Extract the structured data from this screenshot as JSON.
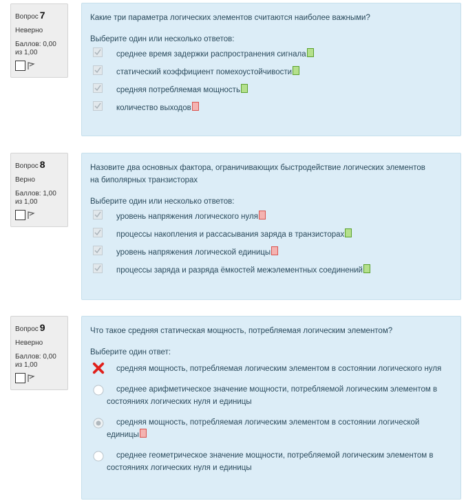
{
  "questions": [
    {
      "label": "Вопрос",
      "number": "7",
      "state": "Неверно",
      "grade_line1": "Баллов: 0,00",
      "grade_line2": "из 1,00",
      "text": "Какие три параметра логических элементов считаются наиболее важными?",
      "prompt": "Выберите один или несколько ответов:",
      "answers": [
        {
          "text": "среднее время задержки распространения сигнала",
          "correct": true
        },
        {
          "text": "статический коэффициент помехоустойчивости",
          "correct": true
        },
        {
          "text": "средняя потребляемая мощность",
          "correct": true
        },
        {
          "text": "количество выходов",
          "correct": false
        }
      ]
    },
    {
      "label": "Вопрос",
      "number": "8",
      "state": "Верно",
      "grade_line1": "Баллов: 1,00",
      "grade_line2": "из 1,00",
      "text_line1": "Назовите два основных фактора, ограничивающих быстродействие логических элементов",
      "text_line2": "на биполярных транзисторах",
      "prompt": "Выберите один или несколько ответов:",
      "answers": [
        {
          "text": "уровень напряжения логического нуля",
          "correct": false
        },
        {
          "text": "процессы накопления и рассасывания заряда в транзисторах",
          "correct": true
        },
        {
          "text": "уровень напряжения логической единицы",
          "correct": false
        },
        {
          "text": "процессы заряда и разряда ёмкостей межэлементных соединений",
          "correct": true
        }
      ]
    },
    {
      "label": "Вопрос",
      "number": "9",
      "state": "Неверно",
      "grade_line1": "Баллов: 0,00",
      "grade_line2": "из 1,00",
      "text": "Что такое средняя статическая мощность, потребляемая логическим элементом?",
      "prompt": "Выберите один ответ:",
      "answers": [
        {
          "text": "средняя мощность, потребляемая логическим элементом в состоянии логического нуля",
          "mark": "wrong"
        },
        {
          "text": "среднее арифметическое значение мощности, потребляемой логическим элементом в состояниях логических нуля и единицы",
          "mark": "none"
        },
        {
          "text": "средняя мощность, потребляемая логическим элементом в состоянии логической единицы",
          "mark": "selected-correct"
        },
        {
          "text": "среднее геометрическое значение мощности, потребляемой логическим элементом в состояниях логических нуля и единицы",
          "mark": "none"
        }
      ]
    }
  ],
  "colors": {
    "panel_bg": "#dcedf7",
    "info_bg": "#eeeeee",
    "correct": "#5aa02c",
    "incorrect": "#d9534f"
  }
}
